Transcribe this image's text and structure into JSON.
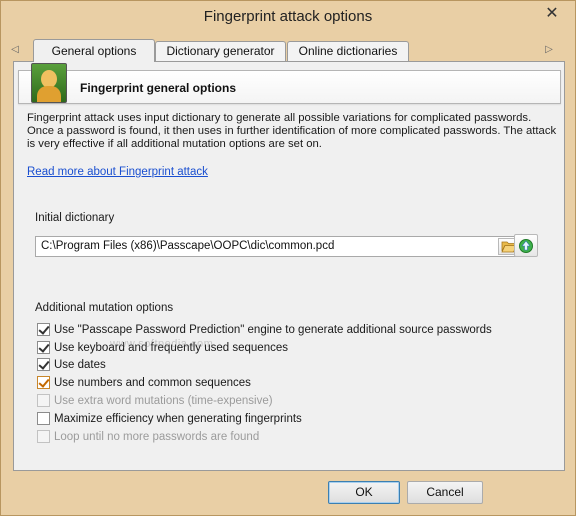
{
  "window": {
    "title": "Fingerprint attack options"
  },
  "tabs": [
    {
      "label": "General options",
      "active": true
    },
    {
      "label": "Dictionary generator",
      "active": false
    },
    {
      "label": "Online dictionaries",
      "active": false
    }
  ],
  "header": {
    "title": "Fingerprint general options",
    "icon": "person-portrait-icon"
  },
  "description": "Fingerprint attack uses input dictionary to generate all possible variations for complicated passwords. Once a password is found, it then uses in further identification of more complicated passwords. The attack is very effective if all additional mutation options are set on.",
  "link_text": "Read more about Fingerprint attack",
  "initial_dictionary": {
    "label": "Initial dictionary",
    "path": "C:\\Program Files (x86)\\Passcape\\OOPC\\dic\\common.pcd"
  },
  "mutation": {
    "label": "Additional mutation options",
    "options": [
      {
        "label": "Use \"Passcape Password Prediction\" engine to generate additional source passwords",
        "checked": true,
        "enabled": true
      },
      {
        "label": "Use keyboard and frequently used sequences",
        "checked": true,
        "enabled": true
      },
      {
        "label": "Use dates",
        "checked": true,
        "enabled": true
      },
      {
        "label": "Use numbers and common sequences",
        "checked": true,
        "enabled": true
      },
      {
        "label": "Use extra word mutations (time-expensive)",
        "checked": false,
        "enabled": false
      },
      {
        "label": "Maximize efficiency when generating fingerprints",
        "checked": false,
        "enabled": true
      },
      {
        "label": "Loop until no more passwords are found",
        "checked": false,
        "enabled": false
      }
    ]
  },
  "watermark": "www.softpedia.com",
  "buttons": {
    "ok": "OK",
    "cancel": "Cancel"
  },
  "colors": {
    "frame": "#e9cfa5",
    "panel": "#f0f0f0",
    "link": "#1a4fd0",
    "accent_check": "#c46a00"
  }
}
